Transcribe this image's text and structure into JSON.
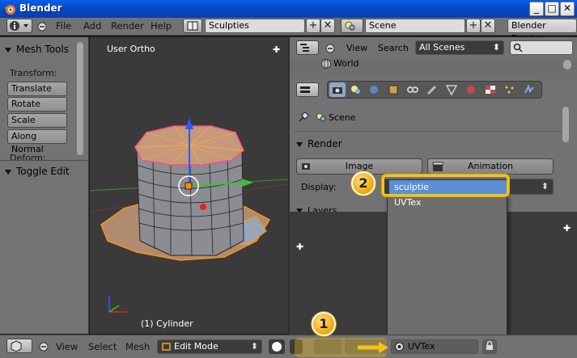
{
  "window": {
    "title": "Blender",
    "minimize": "_",
    "maximize": "□",
    "close": "✕"
  },
  "topbar": {
    "menus": [
      "File",
      "Add",
      "Render",
      "Help"
    ],
    "screen_layout": "Sculpties",
    "scene": "Scene",
    "engine": "Blender Render"
  },
  "shelf": {
    "panel_title": "Mesh Tools",
    "transform_label": "Transform:",
    "buttons": [
      "Translate",
      "Rotate",
      "Scale",
      "Along Normal"
    ],
    "deform_label": "Deform:",
    "toggle_panel": "Toggle Edit"
  },
  "viewport": {
    "view_label": "User Ortho",
    "object_label": "(1) Cylinder"
  },
  "outliner": {
    "menus": [
      "View",
      "Search"
    ],
    "scene_filter": "All Scenes",
    "tree_item": "World"
  },
  "properties": {
    "context_scene": "Scene",
    "render_panel": "Render",
    "image_button": "Image",
    "animation_button": "Animation",
    "display_label": "Display:",
    "layers_panel": "Layers"
  },
  "dropdown": {
    "options": [
      "sculptie",
      "UVTex"
    ],
    "selected": "sculptie"
  },
  "bottombar": {
    "menus": [
      "View",
      "Select",
      "Mesh"
    ],
    "mode": "Edit Mode",
    "uv_field": "UVTex"
  },
  "callouts": [
    "1",
    "2"
  ],
  "colors": {
    "highlight": "#f3c21d",
    "selection": "#5b8fd6",
    "mesh_edge": "#ff8c00"
  }
}
